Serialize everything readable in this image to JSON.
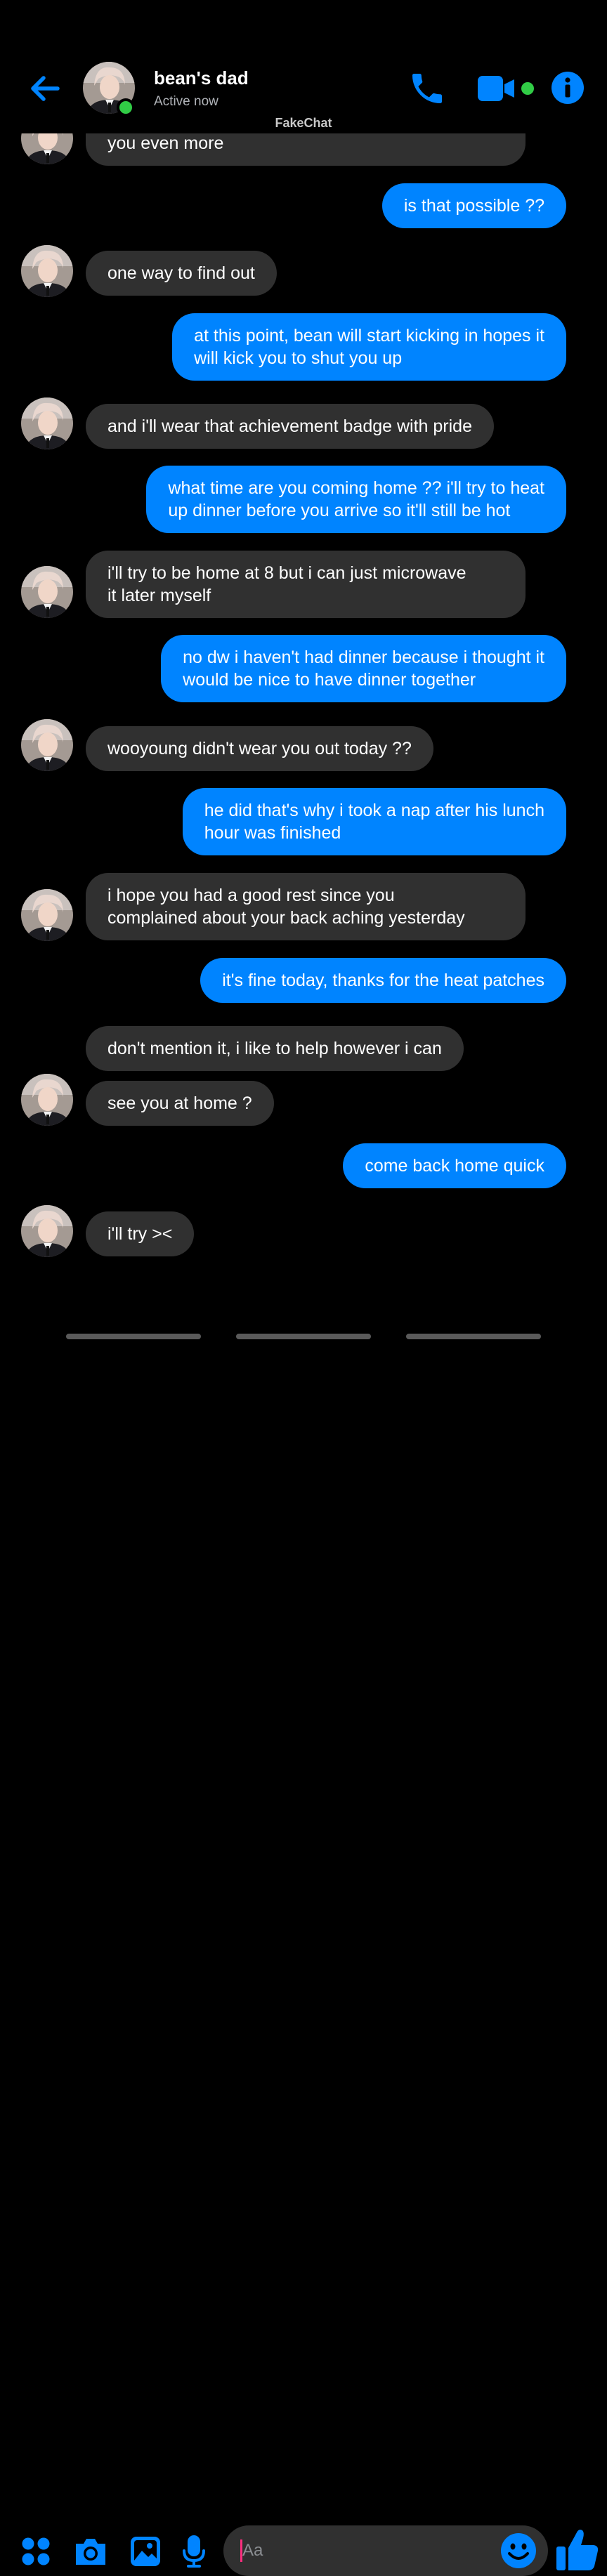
{
  "header": {
    "contact_name": "bean's dad",
    "status": "Active now",
    "watermark": "FakeChat"
  },
  "colors": {
    "accent": "#0084ff",
    "incoming_bubble": "#303030",
    "online": "#31cc46",
    "background": "#000000"
  },
  "messages": [
    {
      "from": "them",
      "lines": [
        "you even more"
      ]
    },
    {
      "from": "me",
      "lines": [
        "is that possible ??"
      ]
    },
    {
      "from": "them",
      "lines": [
        "one way to find out"
      ]
    },
    {
      "from": "me",
      "lines": [
        "at this point, bean will start kicking in hopes it",
        "will kick you to shut you up"
      ]
    },
    {
      "from": "them",
      "lines": [
        "and i'll wear that achievement badge with pride"
      ]
    },
    {
      "from": "me",
      "lines": [
        "what time are you coming home ?? i'll try to heat",
        "up dinner before you arrive so it'll still be hot"
      ]
    },
    {
      "from": "them",
      "lines": [
        "i'll try to be home at 8 but i can just microwave",
        "it later myself"
      ]
    },
    {
      "from": "me",
      "lines": [
        "no dw i haven't had dinner because i thought it",
        "would be nice to have dinner together"
      ]
    },
    {
      "from": "them",
      "lines": [
        "wooyoung didn't wear you out today ??"
      ]
    },
    {
      "from": "me",
      "lines": [
        "he did that's why i took a nap after his lunch",
        "hour was finished"
      ]
    },
    {
      "from": "them",
      "lines": [
        "i hope you had a good rest since you",
        "complained about your back aching yesterday"
      ]
    },
    {
      "from": "me",
      "lines": [
        "it's fine today, thanks for the heat patches"
      ]
    },
    {
      "from": "them",
      "lines": [
        "don't mention it, i like to help however i can"
      ]
    },
    {
      "from": "them",
      "lines": [
        "see you at home ?"
      ]
    },
    {
      "from": "me",
      "lines": [
        "come back home quick"
      ]
    },
    {
      "from": "them",
      "lines": [
        "i'll try ><"
      ]
    }
  ],
  "composer": {
    "placeholder": "Aa",
    "icons": [
      "menu-dots-icon",
      "camera-icon",
      "image-icon",
      "microphone-icon",
      "emoji-icon",
      "thumbs-up-icon"
    ]
  }
}
